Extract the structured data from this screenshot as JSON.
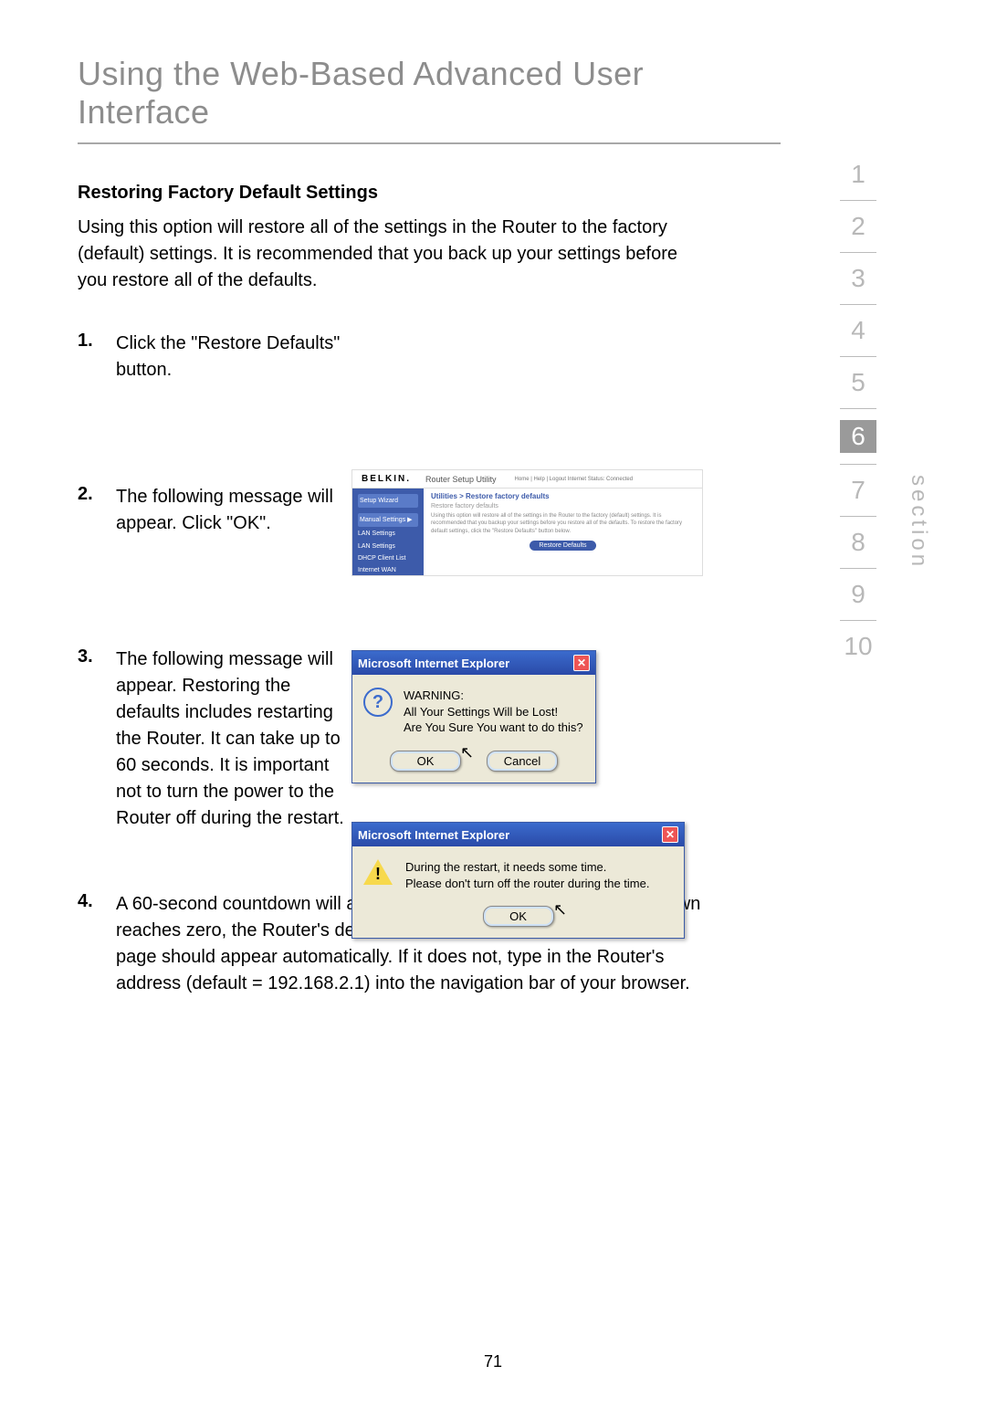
{
  "title": "Using the Web-Based Advanced User Interface",
  "pageNumber": "71",
  "sectionLabel": "section",
  "nav": [
    "1",
    "2",
    "3",
    "4",
    "5",
    "6",
    "7",
    "8",
    "9",
    "10"
  ],
  "navActive": 5,
  "subhead": "Restoring Factory Default Settings",
  "intro": "Using this option will restore all of the settings in the Router to the factory (default) settings. It is recommended that you back up your settings before you restore all of the defaults.",
  "steps": [
    {
      "n": "1.",
      "text": "Click the \"Restore Defaults\" button."
    },
    {
      "n": "2.",
      "text": "The following message will appear. Click \"OK\"."
    },
    {
      "n": "3.",
      "text": "The following message will appear. Restoring the defaults includes restarting the Router. It can take up to 60 seconds. It is important not to turn the power to the Router off during the restart."
    },
    {
      "n": "4.",
      "text": "A 60-second countdown will appear on the screen. When the countdown reaches zero, the Router's defaults will be restored. The Router home page should appear automatically. If it does not, type in the Router's address (default = 192.168.2.1) into the navigation bar of your browser."
    }
  ],
  "fig1": {
    "logo": "BELKIN.",
    "utility": "Router Setup Utility",
    "links": "Home | Help | Logout   Internet Status: Connected",
    "side": {
      "wizard": "Setup Wizard",
      "manual": "Manual Settings ▶",
      "lan": "LAN Settings",
      "lan2": "LAN Settings",
      "dhcp": "DHCP Client List",
      "wan": "Internet WAN"
    },
    "bc": "Utilities > Restore factory defaults",
    "sub": "Restore factory defaults",
    "desc": "Using this option will restore all of the settings in the Router to the factory (default) settings. It is recommended that you backup your settings before you restore all of the defaults. To restore the factory default settings, click the \"Restore Defaults\" button below.",
    "btn": "Restore Defaults"
  },
  "fig2": {
    "title": "Microsoft Internet Explorer",
    "warn": "WARNING:",
    "l1": "All Your Settings Will be Lost!",
    "l2": "Are You Sure You want to do this?",
    "ok": "OK",
    "cancel": "Cancel"
  },
  "fig3": {
    "title": "Microsoft Internet Explorer",
    "l1": "During the restart, it needs some time.",
    "l2": "Please don't turn off the router during the time.",
    "ok": "OK"
  }
}
